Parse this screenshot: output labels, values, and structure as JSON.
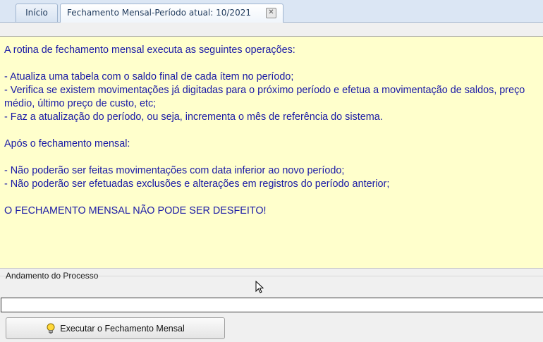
{
  "tabs": [
    {
      "label": "Início"
    },
    {
      "label": "Fechamento Mensal-Período atual: 10/2021"
    }
  ],
  "icons": {
    "tab_close": "close-icon",
    "execute": "lightbulb-icon",
    "cursor": "mouse-pointer-icon"
  },
  "info_panel": {
    "intro": "A rotina de fechamento mensal executa as seguintes operações:",
    "operations": [
      "- Atualiza uma tabela com o saldo final de cada ítem no período;",
      "- Verifica se existem movimentações já digitadas para o próximo período e efetua a movimentação de saldos, preço médio, último preço de custo, etc;",
      "- Faz a atualização do período, ou seja, incrementa o mês de referência do sistema."
    ],
    "after_heading": "Após o fechamento mensal:",
    "after_items": [
      "- Não poderão ser feitas movimentações com data inferior ao novo período;",
      "- Não poderão ser efetuadas exclusões e alterações em registros do período anterior;"
    ],
    "warning": "O FECHAMENTO MENSAL NÃO PODE SER DESFEITO!"
  },
  "process": {
    "group_label": "Andamento do Processo",
    "progress_value": 0
  },
  "execute_button": {
    "label": "Executar o Fechamento Mensal"
  },
  "colors": {
    "info_background": "#ffffcc",
    "info_text": "#1a1aa6"
  }
}
